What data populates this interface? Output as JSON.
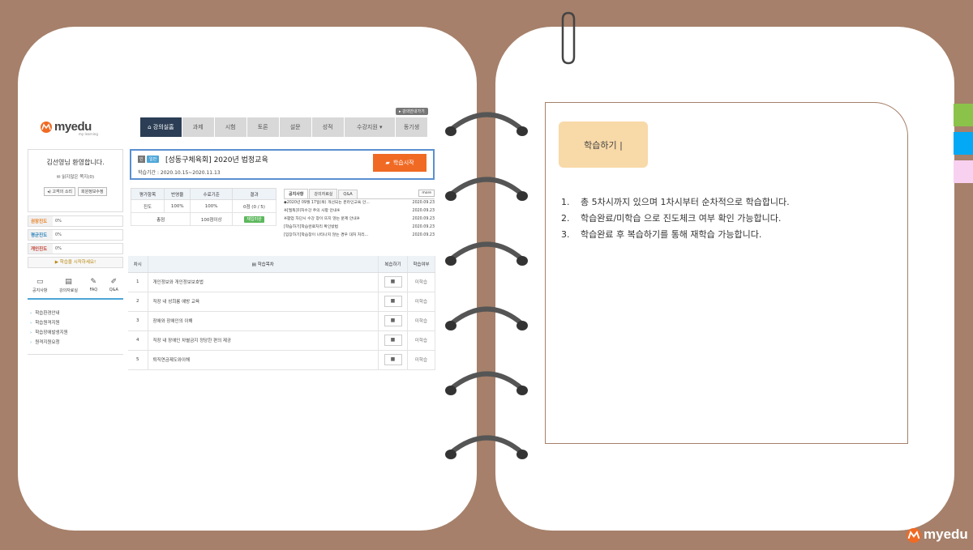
{
  "quick_button": "▸ 강의안내가기",
  "logo": {
    "text": "myedu",
    "sub": "my learning"
  },
  "nav": [
    "강의실홈",
    "과제",
    "시험",
    "토론",
    "설문",
    "성적",
    "수강지원 ▾",
    "동기생"
  ],
  "welcome": {
    "name": "김선영님 환영합니다.",
    "link": "읽지않은 쪽지(0)",
    "btn1": "◂) 고객의 소리",
    "btn2": "회원정보수정"
  },
  "progress": [
    {
      "label": "권장진도",
      "value": "0%"
    },
    {
      "label": "평균진도",
      "value": "0%"
    },
    {
      "label": "개인진도",
      "value": "0%"
    }
  ],
  "progress_notice": "▶ 학습을 시작하세요!",
  "quick_icons": [
    "공지사항",
    "강의자료실",
    "FAQ",
    "Q&A"
  ],
  "menu": [
    "학습환경안내",
    "학습원격지원",
    "학습장애발생지원",
    "원격지원요청"
  ],
  "course": {
    "tag1": "인",
    "tag2": "일반",
    "title": "[성동구체육회] 2020년 법정교육",
    "period": "학습기간 : 2020.10.15~2020.11.13",
    "start": "학습시작"
  },
  "eval": {
    "headers": [
      "평가항목",
      "반영율",
      "수료기준",
      "결과"
    ],
    "row1": [
      "진도",
      "100%",
      "100%",
      "0점 (0 / 5)"
    ],
    "row2_label": "총점",
    "row2_value": "100점이상",
    "row2_badge": "재입미완"
  },
  "board": {
    "tabs": [
      "공지사항",
      "강의자료실",
      "Q&A"
    ],
    "more": "more",
    "rows": [
      {
        "title": "◆2020년 09월 17일(목) 개선되는 온라인교육 안...",
        "date": "2020.09.23"
      },
      {
        "title": "※[필독]미처수강 주의 사항 안내※",
        "date": "2020.09.23"
      },
      {
        "title": "※팝업 차단시 수강 창이 뜨지 않는 문제 안내※",
        "date": "2020.09.23"
      },
      {
        "title": "[학습하기]학습완료처리 확인방법",
        "date": "2020.09.23"
      },
      {
        "title": "[입장하기]학습창이 나타나지 않는 경우 대처 처리...",
        "date": "2020.09.23"
      }
    ]
  },
  "chapters": {
    "headers": [
      "차시",
      "▤ 학습목차",
      "복습하기",
      "학습여부"
    ],
    "rows": [
      {
        "num": "1",
        "title": "개인정보와 개인정보보호법",
        "status": "미학습"
      },
      {
        "num": "2",
        "title": "직장 내 성희롱 예방 교육",
        "status": "미학습"
      },
      {
        "num": "3",
        "title": "장애와 장애인의 이해",
        "status": "미학습"
      },
      {
        "num": "4",
        "title": "직장 내 장애인 차별금지 정당한 편의 제공",
        "status": "미학습"
      },
      {
        "num": "5",
        "title": "퇴직연금제도와이해",
        "status": "미학습"
      }
    ]
  },
  "right": {
    "title": "학습하기 |",
    "instructions": [
      {
        "n": "1.",
        "text": "총 5차시까지 있으며 1차시부터 순차적으로 학습합니다."
      },
      {
        "n": "2.",
        "text": "학습완료/미학습 으로 진도체크 여부 확인 가능합니다."
      },
      {
        "n": "3.",
        "text": "학습완료 후 복습하기를 통해 재학습 가능합니다."
      }
    ]
  },
  "footer_logo": "myedu",
  "colors": {
    "background": "#a6806a",
    "accent": "#f06a24",
    "nav_active": "#2c3e55",
    "tab_green": "#8bc34a",
    "tab_blue": "#03a9f4",
    "tab_pink": "#f8d0f0"
  }
}
